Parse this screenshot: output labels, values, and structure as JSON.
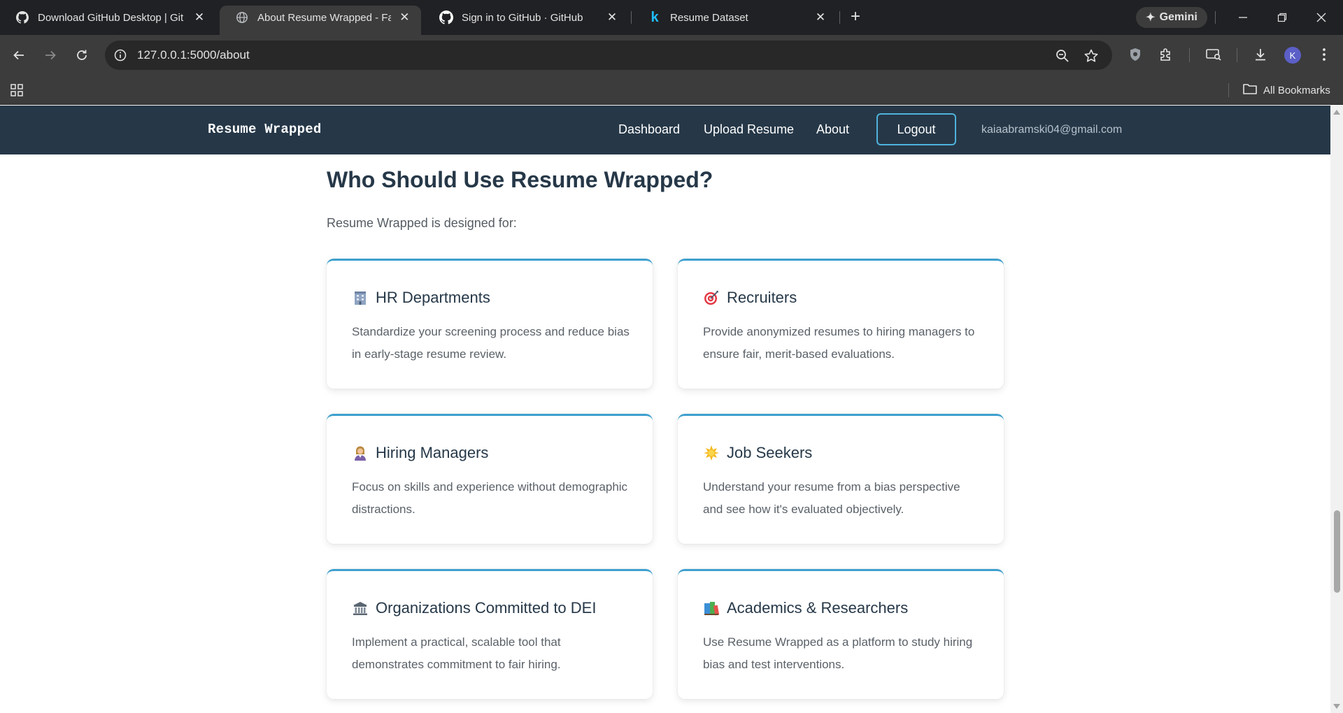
{
  "browser": {
    "tabs": [
      {
        "title": "Download GitHub Desktop | Git",
        "favicon": "github-icon",
        "active": false
      },
      {
        "title": "About Resume Wrapped - Fair H",
        "favicon": "globe-icon",
        "active": true
      },
      {
        "title": "Sign in to GitHub · GitHub",
        "favicon": "github-icon",
        "active": false
      },
      {
        "title": "Resume Dataset",
        "favicon": "kaggle-icon",
        "active": false
      }
    ],
    "gemini_label": "Gemini",
    "url": "127.0.0.1:5000/about",
    "profile_initial": "K",
    "bookmarks_label": "All Bookmarks"
  },
  "site": {
    "brand": "Resume Wrapped",
    "nav": {
      "dashboard": "Dashboard",
      "upload": "Upload Resume",
      "about": "About",
      "logout": "Logout",
      "email": "kaiaabramski04@gmail.com"
    }
  },
  "section": {
    "heading": "Who Should Use Resume Wrapped?",
    "intro": "Resume Wrapped is designed for:",
    "cards": [
      {
        "icon": "office-building-icon",
        "title": "HR Departments",
        "desc": "Standardize your screening process and reduce bias in early-stage resume review."
      },
      {
        "icon": "target-icon",
        "title": "Recruiters",
        "desc": "Provide anonymized resumes to hiring managers to ensure fair, merit-based evaluations."
      },
      {
        "icon": "manager-person-icon",
        "title": "Hiring Managers",
        "desc": "Focus on skills and experience without demographic distractions."
      },
      {
        "icon": "sparkle-icon",
        "title": "Job Seekers",
        "desc": "Understand your resume from a bias perspective and see how it's evaluated objectively."
      },
      {
        "icon": "classical-building-icon",
        "title": "Organizations Committed to DEI",
        "desc": "Implement a practical, scalable tool that demonstrates commitment to fair hiring."
      },
      {
        "icon": "books-icon",
        "title": "Academics & Researchers",
        "desc": "Use Resume Wrapped as a platform to study hiring bias and test interventions."
      }
    ]
  },
  "colors": {
    "nav_bg": "#263848",
    "accent": "#3ea0cf",
    "heading": "#263848"
  }
}
